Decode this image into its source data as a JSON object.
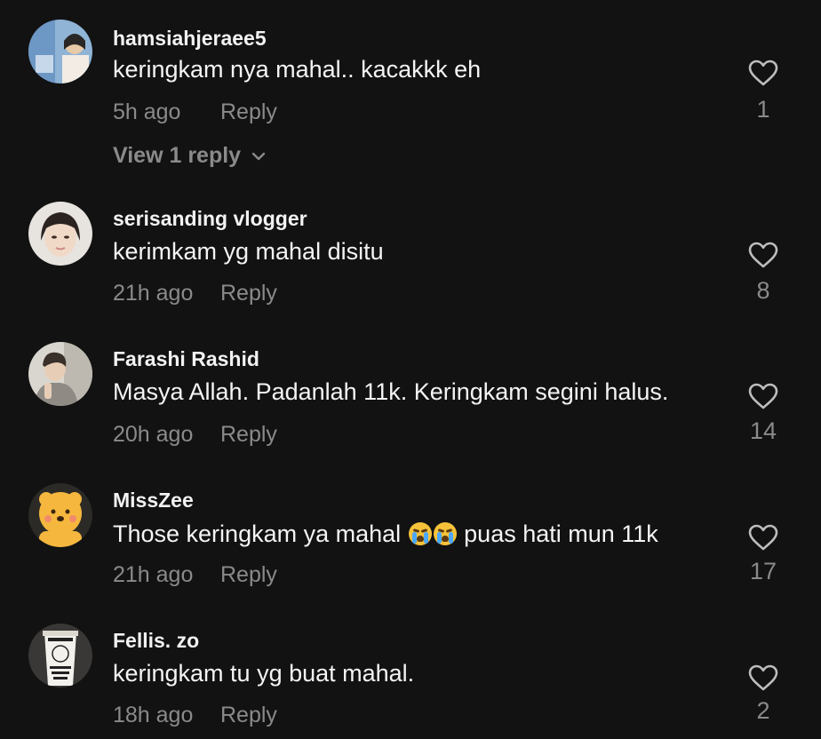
{
  "comments": [
    {
      "username": "hamsiahjeraee5",
      "text": "keringkam nya mahal.. kacakkk eh",
      "time": "5h ago",
      "reply_label": "Reply",
      "likes": "1",
      "view_replies": "View 1 reply",
      "avatar_icon": "avatar-photo"
    },
    {
      "username": "serisanding vlogger",
      "text": "kerimkam yg mahal disitu",
      "time": "21h ago",
      "reply_label": "Reply",
      "likes": "8",
      "avatar_icon": "avatar-photo"
    },
    {
      "username": "Farashi Rashid",
      "text": "Masya Allah. Padanlah 11k. Keringkam segini halus.",
      "time": "20h ago",
      "reply_label": "Reply",
      "likes": "14",
      "avatar_icon": "avatar-photo"
    },
    {
      "username": "MissZee",
      "text_before": "Those keringkam ya mahal ",
      "text_after": " puas hati mun 11k",
      "emoji": "loudly-crying-face-icon",
      "time": "21h ago",
      "reply_label": "Reply",
      "likes": "17",
      "avatar_icon": "avatar-photo"
    },
    {
      "username": "Fellis. zo",
      "text": "keringkam tu yg buat mahal.",
      "time": "18h ago",
      "reply_label": "Reply",
      "likes": "2",
      "avatar_icon": "avatar-photo"
    }
  ],
  "colors": {
    "background": "#121212",
    "primary_text": "#f4f4f4",
    "secondary_text": "#8a8a8a"
  }
}
